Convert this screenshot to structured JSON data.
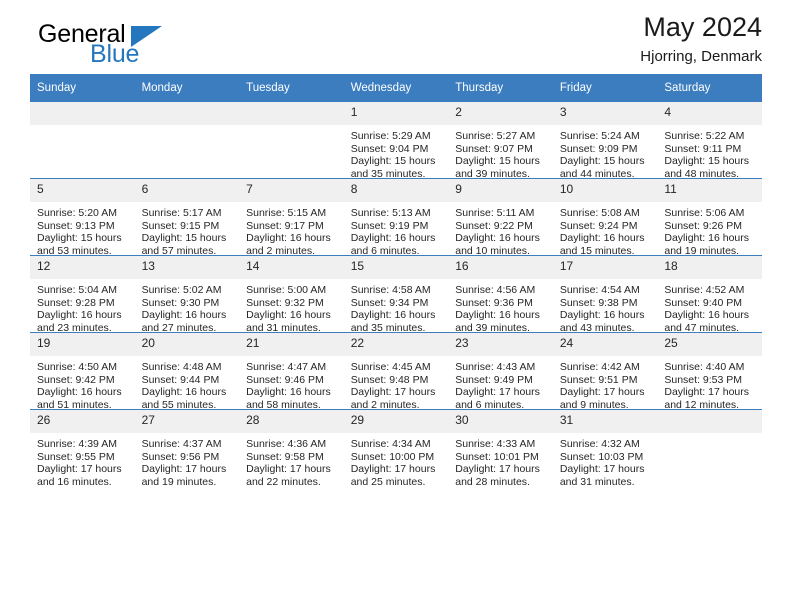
{
  "brand": {
    "name_top": "General",
    "name_bottom": "Blue",
    "triangle_color": "#2477bf"
  },
  "header": {
    "title": "May 2024",
    "subtitle": "Hjorring, Denmark",
    "accent_color": "#3b7dbf"
  },
  "weekdays": [
    "Sunday",
    "Monday",
    "Tuesday",
    "Wednesday",
    "Thursday",
    "Friday",
    "Saturday"
  ],
  "labels": {
    "sunrise": "Sunrise:",
    "sunset": "Sunset:",
    "daylight": "Daylight:"
  },
  "weeks": [
    [
      {
        "day": "",
        "sunrise": "",
        "sunset": "",
        "daylight_line1": "",
        "daylight_line2": ""
      },
      {
        "day": "",
        "sunrise": "",
        "sunset": "",
        "daylight_line1": "",
        "daylight_line2": ""
      },
      {
        "day": "",
        "sunrise": "",
        "sunset": "",
        "daylight_line1": "",
        "daylight_line2": ""
      },
      {
        "day": "1",
        "sunrise": "Sunrise: 5:29 AM",
        "sunset": "Sunset: 9:04 PM",
        "daylight_line1": "Daylight: 15 hours",
        "daylight_line2": "and 35 minutes."
      },
      {
        "day": "2",
        "sunrise": "Sunrise: 5:27 AM",
        "sunset": "Sunset: 9:07 PM",
        "daylight_line1": "Daylight: 15 hours",
        "daylight_line2": "and 39 minutes."
      },
      {
        "day": "3",
        "sunrise": "Sunrise: 5:24 AM",
        "sunset": "Sunset: 9:09 PM",
        "daylight_line1": "Daylight: 15 hours",
        "daylight_line2": "and 44 minutes."
      },
      {
        "day": "4",
        "sunrise": "Sunrise: 5:22 AM",
        "sunset": "Sunset: 9:11 PM",
        "daylight_line1": "Daylight: 15 hours",
        "daylight_line2": "and 48 minutes."
      }
    ],
    [
      {
        "day": "5",
        "sunrise": "Sunrise: 5:20 AM",
        "sunset": "Sunset: 9:13 PM",
        "daylight_line1": "Daylight: 15 hours",
        "daylight_line2": "and 53 minutes."
      },
      {
        "day": "6",
        "sunrise": "Sunrise: 5:17 AM",
        "sunset": "Sunset: 9:15 PM",
        "daylight_line1": "Daylight: 15 hours",
        "daylight_line2": "and 57 minutes."
      },
      {
        "day": "7",
        "sunrise": "Sunrise: 5:15 AM",
        "sunset": "Sunset: 9:17 PM",
        "daylight_line1": "Daylight: 16 hours",
        "daylight_line2": "and 2 minutes."
      },
      {
        "day": "8",
        "sunrise": "Sunrise: 5:13 AM",
        "sunset": "Sunset: 9:19 PM",
        "daylight_line1": "Daylight: 16 hours",
        "daylight_line2": "and 6 minutes."
      },
      {
        "day": "9",
        "sunrise": "Sunrise: 5:11 AM",
        "sunset": "Sunset: 9:22 PM",
        "daylight_line1": "Daylight: 16 hours",
        "daylight_line2": "and 10 minutes."
      },
      {
        "day": "10",
        "sunrise": "Sunrise: 5:08 AM",
        "sunset": "Sunset: 9:24 PM",
        "daylight_line1": "Daylight: 16 hours",
        "daylight_line2": "and 15 minutes."
      },
      {
        "day": "11",
        "sunrise": "Sunrise: 5:06 AM",
        "sunset": "Sunset: 9:26 PM",
        "daylight_line1": "Daylight: 16 hours",
        "daylight_line2": "and 19 minutes."
      }
    ],
    [
      {
        "day": "12",
        "sunrise": "Sunrise: 5:04 AM",
        "sunset": "Sunset: 9:28 PM",
        "daylight_line1": "Daylight: 16 hours",
        "daylight_line2": "and 23 minutes."
      },
      {
        "day": "13",
        "sunrise": "Sunrise: 5:02 AM",
        "sunset": "Sunset: 9:30 PM",
        "daylight_line1": "Daylight: 16 hours",
        "daylight_line2": "and 27 minutes."
      },
      {
        "day": "14",
        "sunrise": "Sunrise: 5:00 AM",
        "sunset": "Sunset: 9:32 PM",
        "daylight_line1": "Daylight: 16 hours",
        "daylight_line2": "and 31 minutes."
      },
      {
        "day": "15",
        "sunrise": "Sunrise: 4:58 AM",
        "sunset": "Sunset: 9:34 PM",
        "daylight_line1": "Daylight: 16 hours",
        "daylight_line2": "and 35 minutes."
      },
      {
        "day": "16",
        "sunrise": "Sunrise: 4:56 AM",
        "sunset": "Sunset: 9:36 PM",
        "daylight_line1": "Daylight: 16 hours",
        "daylight_line2": "and 39 minutes."
      },
      {
        "day": "17",
        "sunrise": "Sunrise: 4:54 AM",
        "sunset": "Sunset: 9:38 PM",
        "daylight_line1": "Daylight: 16 hours",
        "daylight_line2": "and 43 minutes."
      },
      {
        "day": "18",
        "sunrise": "Sunrise: 4:52 AM",
        "sunset": "Sunset: 9:40 PM",
        "daylight_line1": "Daylight: 16 hours",
        "daylight_line2": "and 47 minutes."
      }
    ],
    [
      {
        "day": "19",
        "sunrise": "Sunrise: 4:50 AM",
        "sunset": "Sunset: 9:42 PM",
        "daylight_line1": "Daylight: 16 hours",
        "daylight_line2": "and 51 minutes."
      },
      {
        "day": "20",
        "sunrise": "Sunrise: 4:48 AM",
        "sunset": "Sunset: 9:44 PM",
        "daylight_line1": "Daylight: 16 hours",
        "daylight_line2": "and 55 minutes."
      },
      {
        "day": "21",
        "sunrise": "Sunrise: 4:47 AM",
        "sunset": "Sunset: 9:46 PM",
        "daylight_line1": "Daylight: 16 hours",
        "daylight_line2": "and 58 minutes."
      },
      {
        "day": "22",
        "sunrise": "Sunrise: 4:45 AM",
        "sunset": "Sunset: 9:48 PM",
        "daylight_line1": "Daylight: 17 hours",
        "daylight_line2": "and 2 minutes."
      },
      {
        "day": "23",
        "sunrise": "Sunrise: 4:43 AM",
        "sunset": "Sunset: 9:49 PM",
        "daylight_line1": "Daylight: 17 hours",
        "daylight_line2": "and 6 minutes."
      },
      {
        "day": "24",
        "sunrise": "Sunrise: 4:42 AM",
        "sunset": "Sunset: 9:51 PM",
        "daylight_line1": "Daylight: 17 hours",
        "daylight_line2": "and 9 minutes."
      },
      {
        "day": "25",
        "sunrise": "Sunrise: 4:40 AM",
        "sunset": "Sunset: 9:53 PM",
        "daylight_line1": "Daylight: 17 hours",
        "daylight_line2": "and 12 minutes."
      }
    ],
    [
      {
        "day": "26",
        "sunrise": "Sunrise: 4:39 AM",
        "sunset": "Sunset: 9:55 PM",
        "daylight_line1": "Daylight: 17 hours",
        "daylight_line2": "and 16 minutes."
      },
      {
        "day": "27",
        "sunrise": "Sunrise: 4:37 AM",
        "sunset": "Sunset: 9:56 PM",
        "daylight_line1": "Daylight: 17 hours",
        "daylight_line2": "and 19 minutes."
      },
      {
        "day": "28",
        "sunrise": "Sunrise: 4:36 AM",
        "sunset": "Sunset: 9:58 PM",
        "daylight_line1": "Daylight: 17 hours",
        "daylight_line2": "and 22 minutes."
      },
      {
        "day": "29",
        "sunrise": "Sunrise: 4:34 AM",
        "sunset": "Sunset: 10:00 PM",
        "daylight_line1": "Daylight: 17 hours",
        "daylight_line2": "and 25 minutes."
      },
      {
        "day": "30",
        "sunrise": "Sunrise: 4:33 AM",
        "sunset": "Sunset: 10:01 PM",
        "daylight_line1": "Daylight: 17 hours",
        "daylight_line2": "and 28 minutes."
      },
      {
        "day": "31",
        "sunrise": "Sunrise: 4:32 AM",
        "sunset": "Sunset: 10:03 PM",
        "daylight_line1": "Daylight: 17 hours",
        "daylight_line2": "and 31 minutes."
      },
      {
        "day": "",
        "sunrise": "",
        "sunset": "",
        "daylight_line1": "",
        "daylight_line2": ""
      }
    ]
  ]
}
